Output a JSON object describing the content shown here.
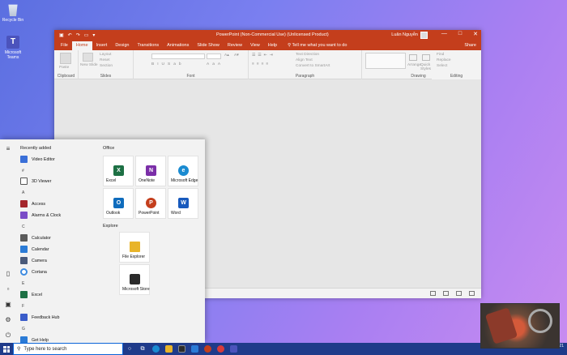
{
  "desktop": {
    "icons": [
      {
        "label": "Recycle Bin"
      },
      {
        "label": "Microsoft Teams"
      }
    ]
  },
  "powerpoint": {
    "title": "PowerPoint (Non-Commercial Use) (Unlicensed Product)",
    "user": "Luân Nguyễn",
    "window_controls": [
      "—",
      "□",
      "✕"
    ],
    "tabs": [
      "File",
      "Home",
      "Insert",
      "Design",
      "Transitions",
      "Animations",
      "Slide Show",
      "Review",
      "View",
      "Help"
    ],
    "active_tab": "Home",
    "tell_me": "Tell me what you want to do",
    "share": "Share",
    "ribbon": {
      "clipboard": {
        "label": "Clipboard",
        "paste": "Paste"
      },
      "slides": {
        "label": "Slides",
        "new_slide": "New Slide",
        "layout": "Layout",
        "reset": "Reset",
        "section": "Section"
      },
      "font": {
        "label": "Font"
      },
      "paragraph": {
        "label": "Paragraph",
        "text_direction": "Text Direction",
        "align_text": "Align Text",
        "smartart": "Convert to SmartArt"
      },
      "drawing": {
        "label": "Drawing",
        "arrange": "Arrange",
        "quick_styles": "Quick Styles",
        "shape_fill": "Shape Fill",
        "shape_outline": "Shape Outline",
        "shape_effects": "Shape Effects"
      },
      "editing": {
        "label": "Editing",
        "find": "Find",
        "replace": "Replace",
        "select": "Select"
      }
    }
  },
  "start_menu": {
    "recently_added": "Recently added",
    "apps": [
      {
        "type": "app",
        "label": "Video Editor",
        "color": "#3a6fd8"
      },
      {
        "type": "letter",
        "label": "#"
      },
      {
        "type": "app",
        "label": "3D Viewer",
        "color": "#555555"
      },
      {
        "type": "letter",
        "label": "A"
      },
      {
        "type": "app",
        "label": "Access",
        "color": "#a4262c"
      },
      {
        "type": "app",
        "label": "Alarms & Clock",
        "color": "#7a4cc7"
      },
      {
        "type": "letter",
        "label": "C"
      },
      {
        "type": "app",
        "label": "Calculator",
        "color": "#5a5a5a"
      },
      {
        "type": "app",
        "label": "Calendar",
        "color": "#2b7bd6"
      },
      {
        "type": "app",
        "label": "Camera",
        "color": "#4a5a7a"
      },
      {
        "type": "app",
        "label": "Cortana",
        "color": "#3d8be0"
      },
      {
        "type": "letter",
        "label": "E"
      },
      {
        "type": "app",
        "label": "Excel",
        "color": "#1d7044"
      },
      {
        "type": "letter",
        "label": "F"
      },
      {
        "type": "app",
        "label": "Feedback Hub",
        "color": "#3a5cc9"
      },
      {
        "type": "letter",
        "label": "G"
      },
      {
        "type": "app",
        "label": "Get Help",
        "color": "#2b7bd6"
      }
    ],
    "office_heading": "Office",
    "office_tiles": [
      {
        "label": "Excel",
        "glyph": "X",
        "color": "#1d7044"
      },
      {
        "label": "OneNote",
        "glyph": "N",
        "color": "#7b2fa8"
      },
      {
        "label": "Microsoft Edge",
        "glyph": "e",
        "color": "#1a8bd1"
      },
      {
        "label": "Outlook",
        "glyph": "O",
        "color": "#0f6cbd"
      },
      {
        "label": "PowerPoint",
        "glyph": "P",
        "color": "#c43e1c"
      },
      {
        "label": "Word",
        "glyph": "W",
        "color": "#185abd"
      }
    ],
    "explore_heading": "Explore",
    "explore_tiles": [
      {
        "label": "File Explorer",
        "color": "#e8b42a"
      },
      {
        "label": "Microsoft Store",
        "color": "#2b2b2b"
      }
    ]
  },
  "taskbar": {
    "search_placeholder": "Type here to search",
    "time": "",
    "date": "8/7/2021"
  },
  "colors": {
    "powerpoint_brand": "#c43e1c",
    "taskbar": "#1f3b8a"
  }
}
